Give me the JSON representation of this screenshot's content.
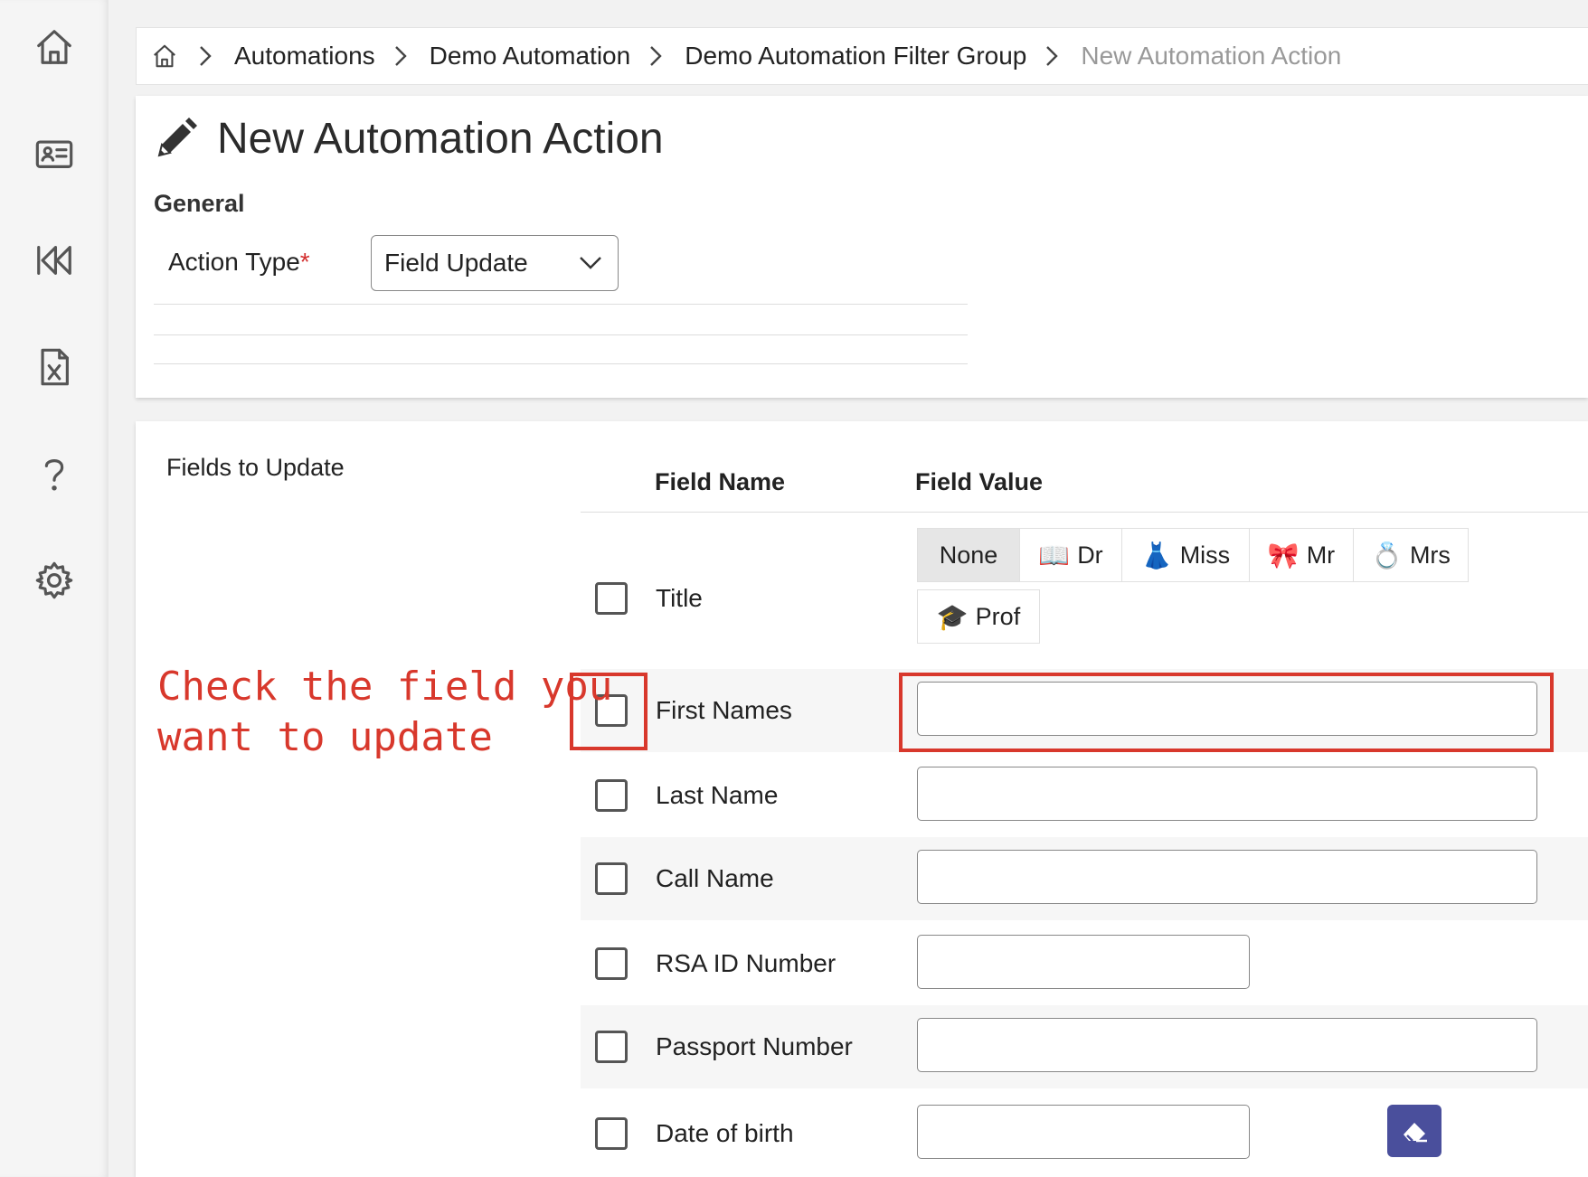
{
  "sidebar": {
    "items": [
      {
        "icon": "home-icon"
      },
      {
        "icon": "contact-card-icon"
      },
      {
        "icon": "rewind-icon"
      },
      {
        "icon": "excel-file-icon"
      },
      {
        "icon": "help-icon"
      },
      {
        "icon": "gear-icon"
      }
    ]
  },
  "breadcrumb": {
    "items": [
      "Automations",
      "Demo Automation",
      "Demo Automation Filter Group"
    ],
    "current": "New Automation Action"
  },
  "page": {
    "title": "New Automation Action",
    "section_general": "General",
    "action_type_label": "Action Type",
    "required_marker": "*",
    "action_type_value": "Field Update"
  },
  "fields": {
    "section_label": "Fields to Update",
    "col_field_name": "Field Name",
    "col_field_value": "Field Value",
    "title_options": [
      {
        "label": "None",
        "emoji": "",
        "selected": true
      },
      {
        "label": "Dr",
        "emoji": "📖",
        "selected": false
      },
      {
        "label": "Miss",
        "emoji": "👗",
        "selected": false
      },
      {
        "label": "Mr",
        "emoji": "🎀",
        "selected": false
      },
      {
        "label": "Mrs",
        "emoji": "💍",
        "selected": false
      },
      {
        "label": "Prof",
        "emoji": "🎓",
        "selected": false
      }
    ],
    "rows": [
      {
        "label": "Title"
      },
      {
        "label": "First Names"
      },
      {
        "label": "Last Name"
      },
      {
        "label": "Call Name"
      },
      {
        "label": "RSA ID Number"
      },
      {
        "label": "Passport Number"
      },
      {
        "label": "Date of birth"
      }
    ]
  },
  "annotation": {
    "line1": "Check the field you",
    "line2": "want to update",
    "color": "#d8382c"
  },
  "colors": {
    "accent_button": "#4a4f9c",
    "required": "#d32f2f"
  }
}
